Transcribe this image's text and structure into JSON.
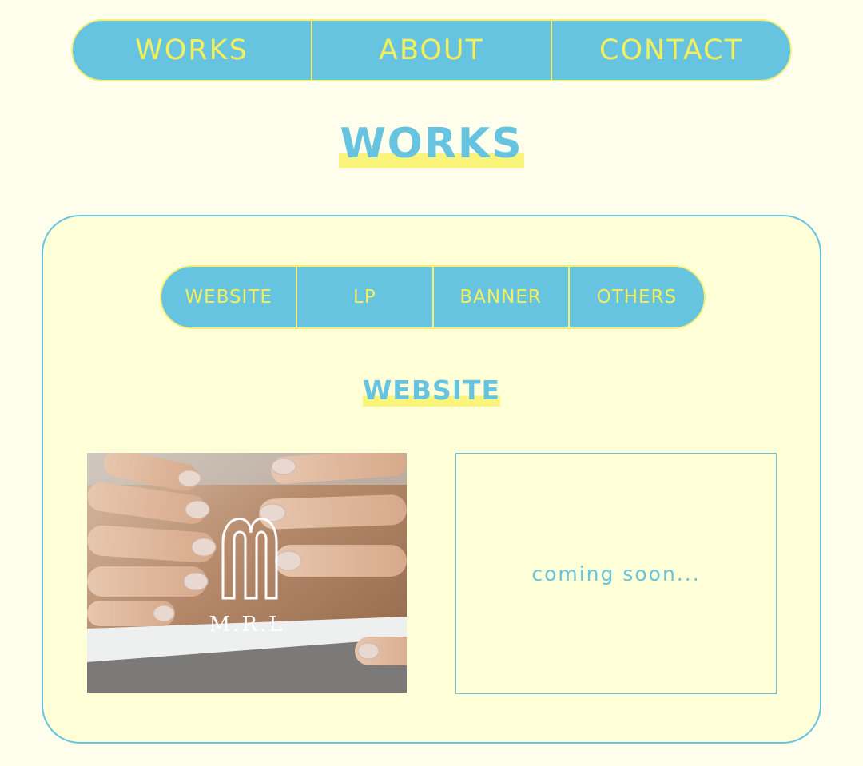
{
  "nav": {
    "items": [
      {
        "label": "WORKS"
      },
      {
        "label": "ABOUT"
      },
      {
        "label": "CONTACT"
      }
    ]
  },
  "page_title": "WORKS",
  "works": {
    "filters": [
      {
        "label": "WEBSITE"
      },
      {
        "label": "LP"
      },
      {
        "label": "BANNER"
      },
      {
        "label": "OTHERS"
      }
    ],
    "section_title": "WEBSITE",
    "cards": [
      {
        "brand": "M.R.L",
        "icon": "nail-salon-photo"
      },
      {
        "status": "coming soon..."
      }
    ]
  },
  "colors": {
    "background": "#fffeec",
    "panel": "#ffffd8",
    "accent_blue": "#66c4e0",
    "accent_yellow": "#f6ef5c"
  }
}
